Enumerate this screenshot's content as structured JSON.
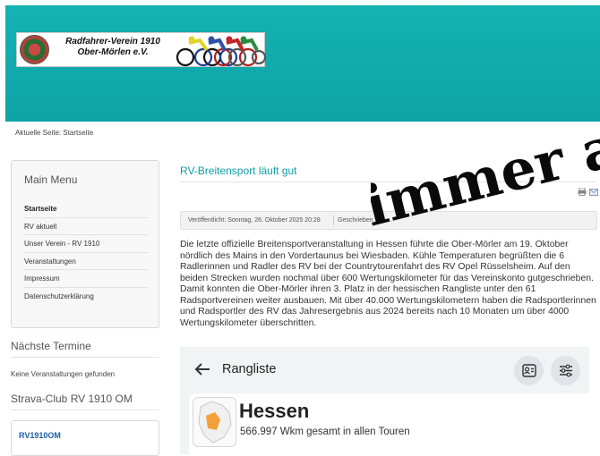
{
  "header": {
    "club_name_line1": "Radfahrer-Verein 1910",
    "club_name_line2": "Ober-Mörlen e.V.",
    "logo_icon": "club-crest-icon",
    "banner_icon": "cyclists-icon",
    "band_color": "#12acae"
  },
  "breadcrumb": "Aktuelle Seite: Startseite",
  "sidebar": {
    "main_menu_title": "Main Menu",
    "items": [
      {
        "label": "Startseite",
        "active": true
      },
      {
        "label": "RV aktuell"
      },
      {
        "label": "Unser Verein - RV 1910"
      },
      {
        "label": "Veranstaltungen"
      },
      {
        "label": "Impressum"
      },
      {
        "label": "Datenschutzerklärung"
      }
    ],
    "termine_title": "Nächste Termine",
    "termine_text": "Keine Veranstaltungen gefunden",
    "strava_title": "Strava-Club RV 1910 OM",
    "strava_link": "RV1910OM"
  },
  "article": {
    "title": "RV-Breitensport läuft gut",
    "published": "Veröffentlicht: Sonntag, 26. Oktober 2025 20:28",
    "author": "Geschrieben von ...",
    "body_lines": [
      "Die letzte offizielle Breitensportveranstaltung in Hessen führte die Ober-Mörler am 19. Oktober",
      "nördlich des Mains in den Vordertaunus bei Wiesbaden. Kühle Temperaturen begrüßten die 6",
      "Radlerinnen und Radler des RV bei der Countrytourenfahrt des RV Opel Rüsselsheim. Auf den",
      "beiden Strecken wurden nochmal über 600 Wertungskilometer für das Vereinskonto gutgeschrieben.",
      "Damit konnten die Ober-Mörler ihren 3. Platz in der hessischen Rangliste unter den 61",
      "Radsportvereinen weiter ausbauen. Mit über 40.000 Wertungskilometern haben die Radsportlerinnen",
      "und Radsportler des RV das Jahresergebnis aus 2024 bereits nach 10 Monaten um über 4000",
      "Wertungskilometer überschritten."
    ],
    "print_icon": "print-icon",
    "email_icon": "email-icon",
    "accent_color": "#0e9ea6"
  },
  "app_screenshot": {
    "title": "Rangliste",
    "region": "Hessen",
    "stats": "566.997 Wkm gesamt in allen Touren",
    "back_icon": "back-arrow-icon",
    "contact_icon": "contact-card-icon",
    "filter_icon": "filter-sliders-icon"
  },
  "overlay_text": "immer a"
}
